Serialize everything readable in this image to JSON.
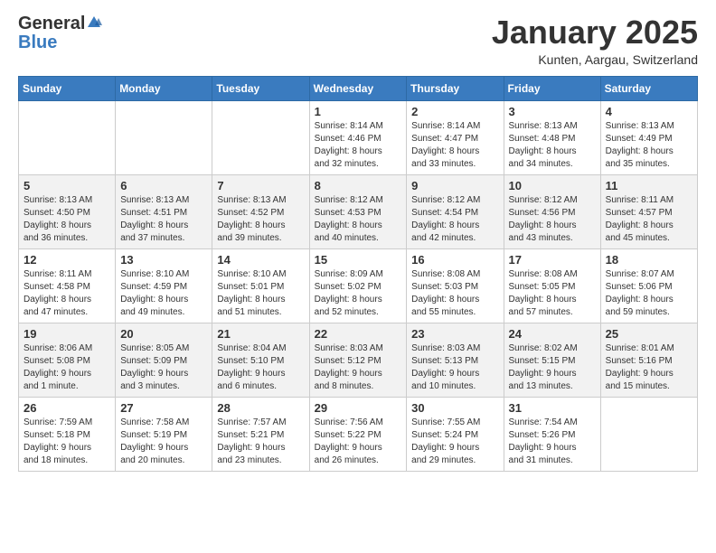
{
  "header": {
    "logo_general": "General",
    "logo_blue": "Blue",
    "month_title": "January 2025",
    "location": "Kunten, Aargau, Switzerland"
  },
  "days_of_week": [
    "Sunday",
    "Monday",
    "Tuesday",
    "Wednesday",
    "Thursday",
    "Friday",
    "Saturday"
  ],
  "weeks": [
    [
      {
        "day": "",
        "info": ""
      },
      {
        "day": "",
        "info": ""
      },
      {
        "day": "",
        "info": ""
      },
      {
        "day": "1",
        "info": "Sunrise: 8:14 AM\nSunset: 4:46 PM\nDaylight: 8 hours\nand 32 minutes."
      },
      {
        "day": "2",
        "info": "Sunrise: 8:14 AM\nSunset: 4:47 PM\nDaylight: 8 hours\nand 33 minutes."
      },
      {
        "day": "3",
        "info": "Sunrise: 8:13 AM\nSunset: 4:48 PM\nDaylight: 8 hours\nand 34 minutes."
      },
      {
        "day": "4",
        "info": "Sunrise: 8:13 AM\nSunset: 4:49 PM\nDaylight: 8 hours\nand 35 minutes."
      }
    ],
    [
      {
        "day": "5",
        "info": "Sunrise: 8:13 AM\nSunset: 4:50 PM\nDaylight: 8 hours\nand 36 minutes."
      },
      {
        "day": "6",
        "info": "Sunrise: 8:13 AM\nSunset: 4:51 PM\nDaylight: 8 hours\nand 37 minutes."
      },
      {
        "day": "7",
        "info": "Sunrise: 8:13 AM\nSunset: 4:52 PM\nDaylight: 8 hours\nand 39 minutes."
      },
      {
        "day": "8",
        "info": "Sunrise: 8:12 AM\nSunset: 4:53 PM\nDaylight: 8 hours\nand 40 minutes."
      },
      {
        "day": "9",
        "info": "Sunrise: 8:12 AM\nSunset: 4:54 PM\nDaylight: 8 hours\nand 42 minutes."
      },
      {
        "day": "10",
        "info": "Sunrise: 8:12 AM\nSunset: 4:56 PM\nDaylight: 8 hours\nand 43 minutes."
      },
      {
        "day": "11",
        "info": "Sunrise: 8:11 AM\nSunset: 4:57 PM\nDaylight: 8 hours\nand 45 minutes."
      }
    ],
    [
      {
        "day": "12",
        "info": "Sunrise: 8:11 AM\nSunset: 4:58 PM\nDaylight: 8 hours\nand 47 minutes."
      },
      {
        "day": "13",
        "info": "Sunrise: 8:10 AM\nSunset: 4:59 PM\nDaylight: 8 hours\nand 49 minutes."
      },
      {
        "day": "14",
        "info": "Sunrise: 8:10 AM\nSunset: 5:01 PM\nDaylight: 8 hours\nand 51 minutes."
      },
      {
        "day": "15",
        "info": "Sunrise: 8:09 AM\nSunset: 5:02 PM\nDaylight: 8 hours\nand 52 minutes."
      },
      {
        "day": "16",
        "info": "Sunrise: 8:08 AM\nSunset: 5:03 PM\nDaylight: 8 hours\nand 55 minutes."
      },
      {
        "day": "17",
        "info": "Sunrise: 8:08 AM\nSunset: 5:05 PM\nDaylight: 8 hours\nand 57 minutes."
      },
      {
        "day": "18",
        "info": "Sunrise: 8:07 AM\nSunset: 5:06 PM\nDaylight: 8 hours\nand 59 minutes."
      }
    ],
    [
      {
        "day": "19",
        "info": "Sunrise: 8:06 AM\nSunset: 5:08 PM\nDaylight: 9 hours\nand 1 minute."
      },
      {
        "day": "20",
        "info": "Sunrise: 8:05 AM\nSunset: 5:09 PM\nDaylight: 9 hours\nand 3 minutes."
      },
      {
        "day": "21",
        "info": "Sunrise: 8:04 AM\nSunset: 5:10 PM\nDaylight: 9 hours\nand 6 minutes."
      },
      {
        "day": "22",
        "info": "Sunrise: 8:03 AM\nSunset: 5:12 PM\nDaylight: 9 hours\nand 8 minutes."
      },
      {
        "day": "23",
        "info": "Sunrise: 8:03 AM\nSunset: 5:13 PM\nDaylight: 9 hours\nand 10 minutes."
      },
      {
        "day": "24",
        "info": "Sunrise: 8:02 AM\nSunset: 5:15 PM\nDaylight: 9 hours\nand 13 minutes."
      },
      {
        "day": "25",
        "info": "Sunrise: 8:01 AM\nSunset: 5:16 PM\nDaylight: 9 hours\nand 15 minutes."
      }
    ],
    [
      {
        "day": "26",
        "info": "Sunrise: 7:59 AM\nSunset: 5:18 PM\nDaylight: 9 hours\nand 18 minutes."
      },
      {
        "day": "27",
        "info": "Sunrise: 7:58 AM\nSunset: 5:19 PM\nDaylight: 9 hours\nand 20 minutes."
      },
      {
        "day": "28",
        "info": "Sunrise: 7:57 AM\nSunset: 5:21 PM\nDaylight: 9 hours\nand 23 minutes."
      },
      {
        "day": "29",
        "info": "Sunrise: 7:56 AM\nSunset: 5:22 PM\nDaylight: 9 hours\nand 26 minutes."
      },
      {
        "day": "30",
        "info": "Sunrise: 7:55 AM\nSunset: 5:24 PM\nDaylight: 9 hours\nand 29 minutes."
      },
      {
        "day": "31",
        "info": "Sunrise: 7:54 AM\nSunset: 5:26 PM\nDaylight: 9 hours\nand 31 minutes."
      },
      {
        "day": "",
        "info": ""
      }
    ]
  ]
}
